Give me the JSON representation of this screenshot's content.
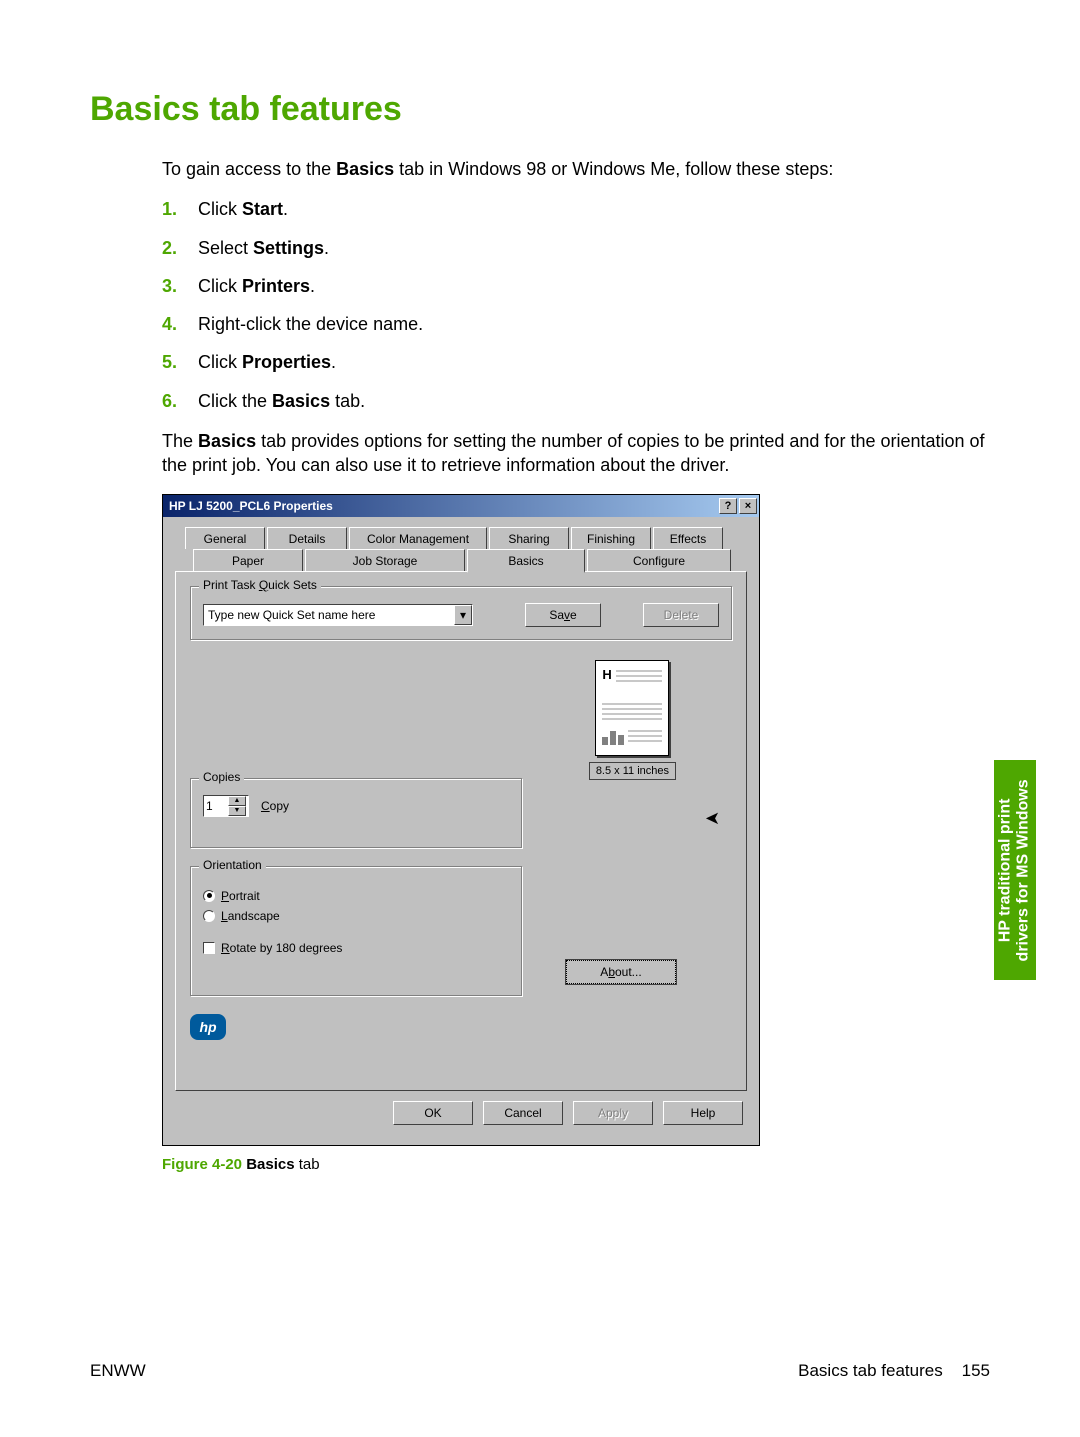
{
  "heading": "Basics tab features",
  "intro_pre": "To gain access to the ",
  "intro_bold": "Basics",
  "intro_post": " tab in Windows 98 or Windows Me, follow these steps:",
  "steps": {
    "s1a": "Click ",
    "s1b": "Start",
    "s1c": ".",
    "s2a": "Select ",
    "s2b": "Settings",
    "s2c": ".",
    "s3a": "Click ",
    "s3b": "Printers",
    "s3c": ".",
    "s4": "Right-click the device name.",
    "s5a": "Click ",
    "s5b": "Properties",
    "s5c": ".",
    "s6a": "Click the ",
    "s6b": "Basics",
    "s6c": " tab."
  },
  "para_pre": "The ",
  "para_bold": "Basics",
  "para_post": " tab provides options for setting the number of copies to be printed and for the orientation of the print job. You can also use it to retrieve information about the driver.",
  "dialog": {
    "title": "HP LJ 5200_PCL6 Properties",
    "help_glyph": "?",
    "close_glyph": "×",
    "tabs_top": [
      "General",
      "Details",
      "Color Management",
      "Sharing",
      "Finishing",
      "Effects"
    ],
    "tabs_bottom": [
      "Paper",
      "Job Storage",
      "Basics",
      "Configure"
    ],
    "active_tab": "Basics",
    "quicksets_label": "Print Task Quick Sets",
    "quicksets_placeholder": "Type new Quick Set name here",
    "save_label": "Save",
    "delete_label": "Delete",
    "paper_h": "H",
    "paper_size": "8.5 x 11 inches",
    "copies_label": "Copies",
    "copies_value": "1",
    "copy_text": "Copy",
    "orientation_label": "Orientation",
    "portrait_label": "Portrait",
    "landscape_label": "Landscape",
    "rotate_label": "Rotate by 180 degrees",
    "about_label": "About...",
    "hp_logo": "hp",
    "ok": "OK",
    "cancel": "Cancel",
    "apply": "Apply",
    "help": "Help"
  },
  "figure": {
    "num": "Figure 4-20",
    "sep": "   ",
    "bold": "Basics",
    "tail": " tab"
  },
  "side_tab_l1": "HP traditional print",
  "side_tab_l2": "drivers for MS Windows",
  "footer_left": "ENWW",
  "footer_right_text": "Basics tab features",
  "footer_page": "155"
}
